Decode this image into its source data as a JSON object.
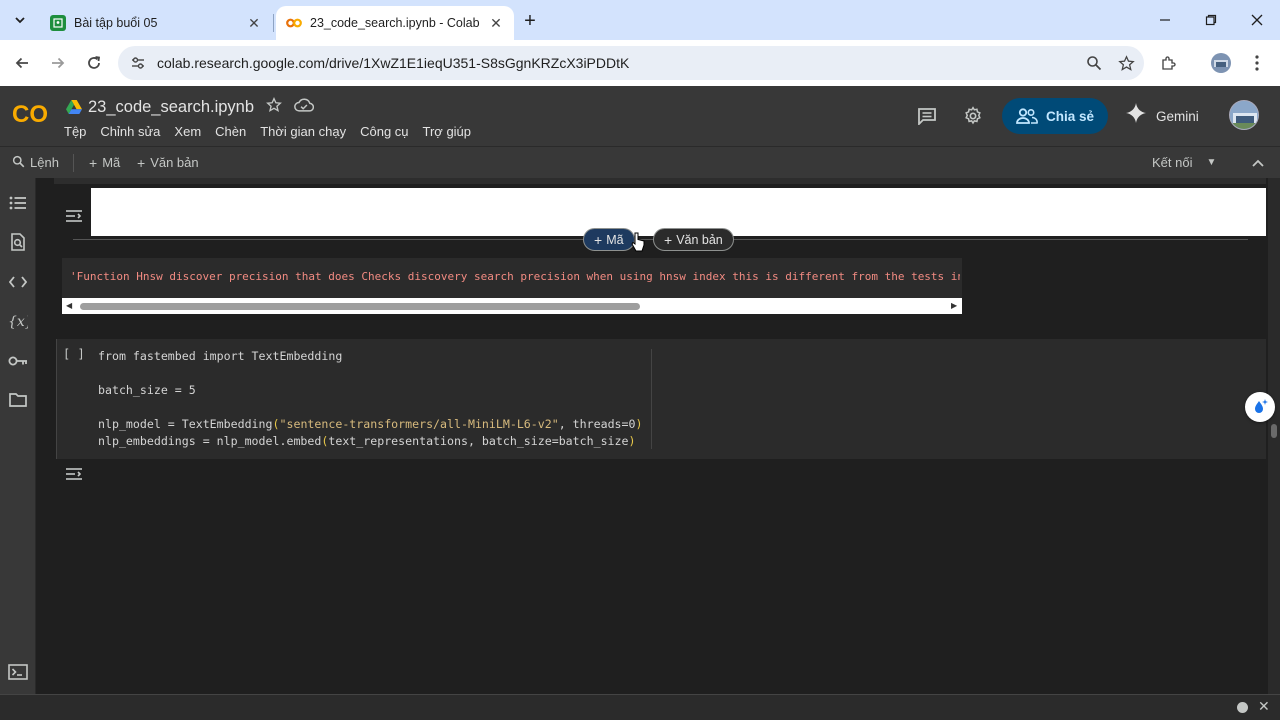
{
  "browser": {
    "tabs": [
      {
        "title": "Bài tập buổi 05",
        "active": false
      },
      {
        "title": "23_code_search.ipynb - Colab",
        "active": true
      }
    ],
    "url": "colab.research.google.com/drive/1XwZ1E1ieqU351-S8sGgnKRZcX3iPDDtK"
  },
  "colab": {
    "logo_text": "CO",
    "notebook_title": "23_code_search.ipynb",
    "menu": [
      "Tệp",
      "Chỉnh sửa",
      "Xem",
      "Chèn",
      "Thời gian chạy",
      "Công cụ",
      "Trợ giúp"
    ],
    "share_label": "Chia sẻ",
    "gemini_label": "Gemini",
    "toolbar": {
      "command_label": "Lệnh",
      "add_code_label": "Mã",
      "add_text_label": "Văn bản",
      "connect_label": "Kết nối"
    }
  },
  "notebook": {
    "insert_code_label": "Mã",
    "insert_text_label": "Văn bản",
    "output_text": "'Function Hnsw discover precision that does Checks discovery search precision when using hnsw index this is different from the tests in defined",
    "code_cell": {
      "run_label": "[ ]",
      "lines": [
        "from fastembed import TextEmbedding",
        "",
        "batch_size = 5",
        "",
        "nlp_model = TextEmbedding(\"sentence-transformers/all-MiniLM-L6-v2\", threads=0)",
        "nlp_embeddings = nlp_model.embed(text_representations, batch_size=batch_size)"
      ]
    }
  },
  "colors": {
    "accent_share_bg": "#004a77",
    "accent_share_text": "#c2e7ff",
    "colab_orange": "#f9ab00",
    "output_string": "#f28b82"
  }
}
